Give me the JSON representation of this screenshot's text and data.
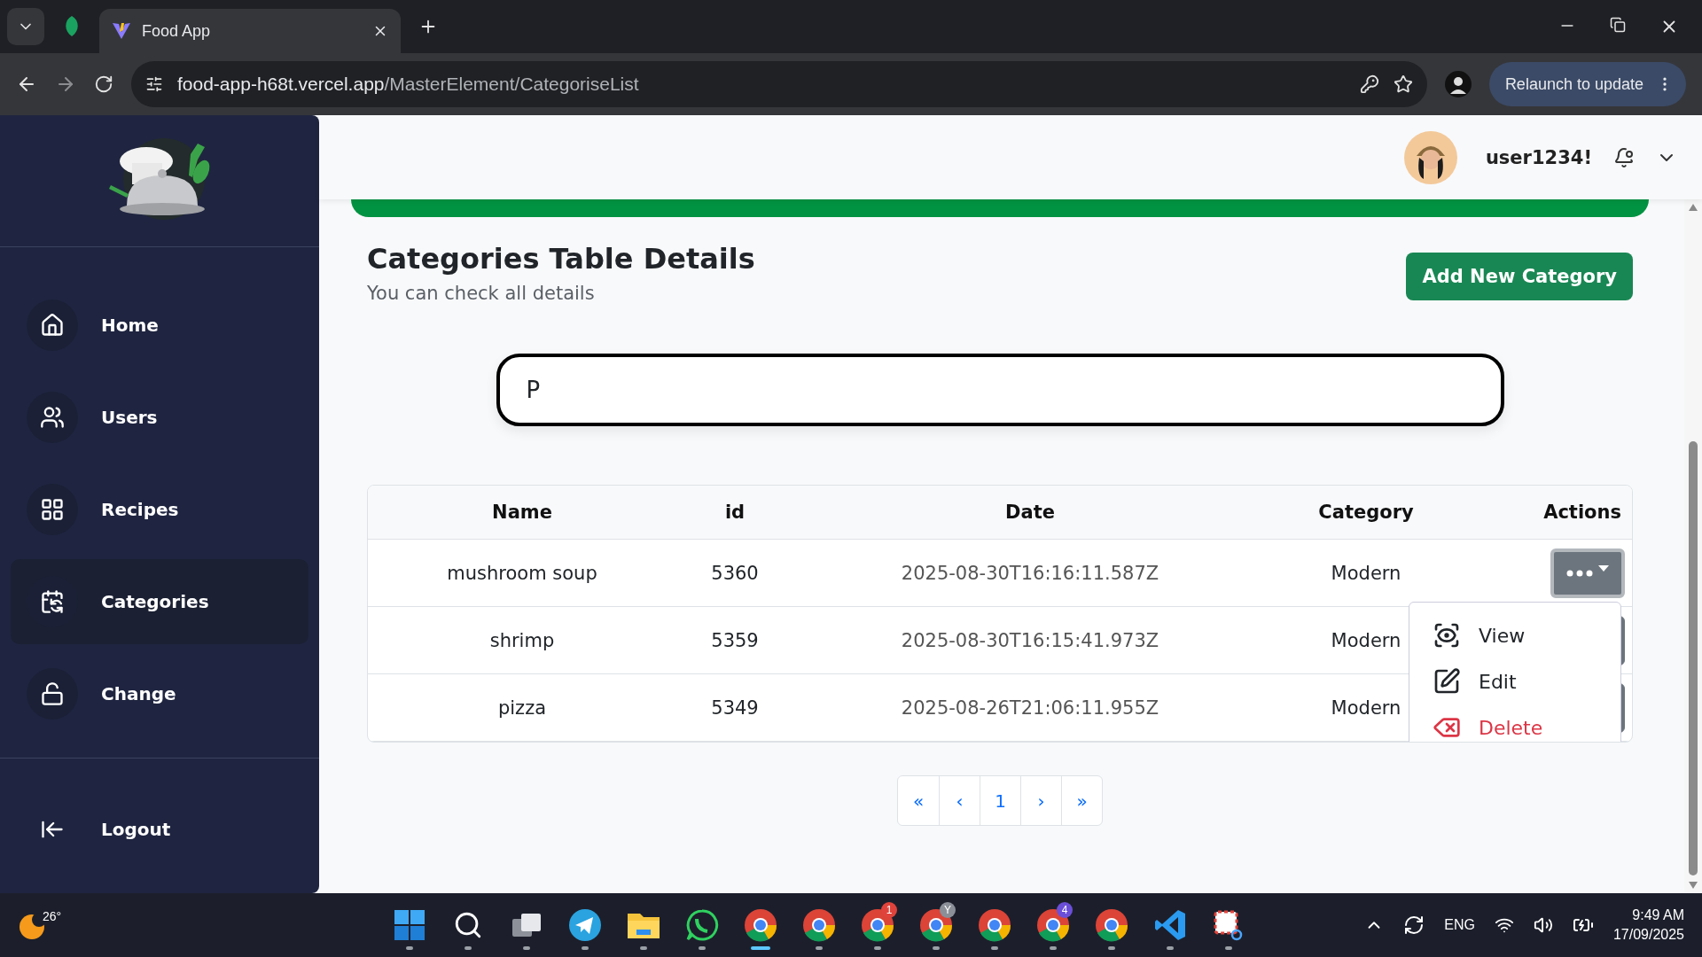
{
  "browser": {
    "tabs": [
      {
        "title": "Food App",
        "selected": true
      }
    ],
    "url_host": "food-app-h68t.vercel.app",
    "url_path": "/MasterElement/CategoriseList",
    "relaunch": "Relaunch to update"
  },
  "sidebar": {
    "items": [
      {
        "label": "Home",
        "kind": "home",
        "selected": false
      },
      {
        "label": "Users",
        "kind": "users",
        "selected": false
      },
      {
        "label": "Recipes",
        "kind": "recipes",
        "selected": false
      },
      {
        "label": "Categories",
        "kind": "categories",
        "selected": true
      },
      {
        "label": "Change",
        "kind": "change",
        "selected": false
      }
    ],
    "logout": "Logout"
  },
  "header": {
    "username": "user1234!"
  },
  "page": {
    "title": "Categories Table Details",
    "subtitle": "You can check all details",
    "add_button": "Add New Category"
  },
  "search": {
    "value": "P"
  },
  "table": {
    "columns": [
      "Name",
      "id",
      "Date",
      "Category",
      "Actions"
    ],
    "rows": [
      {
        "name": "mushroom soup",
        "id": "5360",
        "date": "2025-08-30T16:16:11.587Z",
        "category": "Modern",
        "menu_open": true
      },
      {
        "name": "shrimp",
        "id": "5359",
        "date": "2025-08-30T16:15:41.973Z",
        "category": "Modern",
        "menu_open": false
      },
      {
        "name": "pizza",
        "id": "5349",
        "date": "2025-08-26T21:06:11.955Z",
        "category": "Modern",
        "menu_open": false
      }
    ],
    "action_menu": [
      {
        "label": "View",
        "kind": "view"
      },
      {
        "label": "Edit",
        "kind": "edit"
      },
      {
        "label": "Delete",
        "kind": "delete"
      }
    ]
  },
  "pagination": [
    "«",
    "‹",
    "1",
    "›",
    "»"
  ],
  "taskbar": {
    "weather": "26°",
    "apps": [
      {
        "kind": "start",
        "active": false
      },
      {
        "kind": "search",
        "active": false
      },
      {
        "kind": "taskview",
        "active": false
      },
      {
        "kind": "telegram",
        "active": false
      },
      {
        "kind": "files",
        "active": false
      },
      {
        "kind": "whatsapp",
        "active": false
      },
      {
        "kind": "chrome",
        "active": true
      },
      {
        "kind": "chrome",
        "active": false
      },
      {
        "kind": "chrome",
        "active": false,
        "badge": "1",
        "color": "#e0433b"
      },
      {
        "kind": "chrome",
        "active": false,
        "badge": "Y",
        "color": "#8a8f98"
      },
      {
        "kind": "chrome",
        "active": false
      },
      {
        "kind": "chrome",
        "active": false,
        "badge": "4",
        "color": "#6b4fd8"
      },
      {
        "kind": "chrome",
        "active": false
      },
      {
        "kind": "vscode",
        "active": false
      },
      {
        "kind": "snip",
        "active": false
      }
    ],
    "language": "ENG",
    "time": "9:49 AM",
    "date": "17/09/2025"
  }
}
